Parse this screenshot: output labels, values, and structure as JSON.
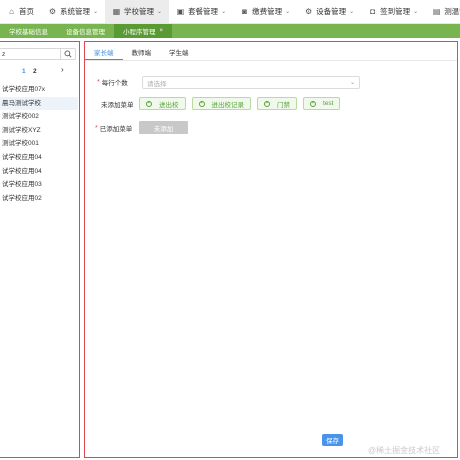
{
  "topnav": {
    "items": [
      {
        "label": "首页",
        "icon": "home-icon",
        "glyph": "⌂",
        "chevron": false,
        "active": false
      },
      {
        "label": "系统管理",
        "icon": "gear-icon",
        "glyph": "⚙",
        "chevron": true,
        "active": false
      },
      {
        "label": "学校管理",
        "icon": "building-icon",
        "glyph": "▦",
        "chevron": true,
        "active": true
      },
      {
        "label": "套餐管理",
        "icon": "briefcase-icon",
        "glyph": "▣",
        "chevron": true,
        "active": false
      },
      {
        "label": "缴费管理",
        "icon": "camera-icon",
        "glyph": "◙",
        "chevron": true,
        "active": false
      },
      {
        "label": "设备管理",
        "icon": "gear-icon",
        "glyph": "⚙",
        "chevron": true,
        "active": false
      },
      {
        "label": "签到管理",
        "icon": "bag-icon",
        "glyph": "◘",
        "chevron": true,
        "active": false
      },
      {
        "label": "测温管理",
        "icon": "thermometer-icon",
        "glyph": "▤",
        "chevron": true,
        "active": false
      }
    ]
  },
  "tabs": [
    {
      "label": "学校基础信息",
      "active": false,
      "closable": false
    },
    {
      "label": "设备信息管理",
      "active": false,
      "closable": false
    },
    {
      "label": "小程序管理",
      "active": true,
      "closable": true,
      "close_glyph": "×"
    }
  ],
  "left": {
    "search_value": "z",
    "search_icon": "search-icon",
    "pager": {
      "page1": "1",
      "page2": "2",
      "next": "›"
    },
    "schools": [
      "试学校应用07x",
      "晨马测试学校",
      "测试学校002",
      "测试学校XYZ",
      "测试学校001",
      "试学校应用04",
      "试学校应用04",
      "试学校应用03",
      "试学校应用02"
    ],
    "selected_index": 1
  },
  "right": {
    "subtabs": [
      "家长端",
      "教师端",
      "学生端"
    ],
    "active_subtab": 0,
    "per_row_label": "每行个数",
    "per_row_placeholder": "请选择",
    "not_added_label": "未添加菜单",
    "menu_buttons": [
      "进出校",
      "进出校记录",
      "门禁",
      "test"
    ],
    "added_label": "已添加菜单",
    "not_added_btn": "未添加",
    "save": "保存",
    "required_mark": "*"
  },
  "watermark": "@稀土掘金技术社区",
  "colors": {
    "accent_blue": "#3a8ee6",
    "tab_green": "#78b450",
    "tab_green_active": "#5a9a35",
    "menu_green": "#57a33a",
    "required_red": "#e04850"
  }
}
